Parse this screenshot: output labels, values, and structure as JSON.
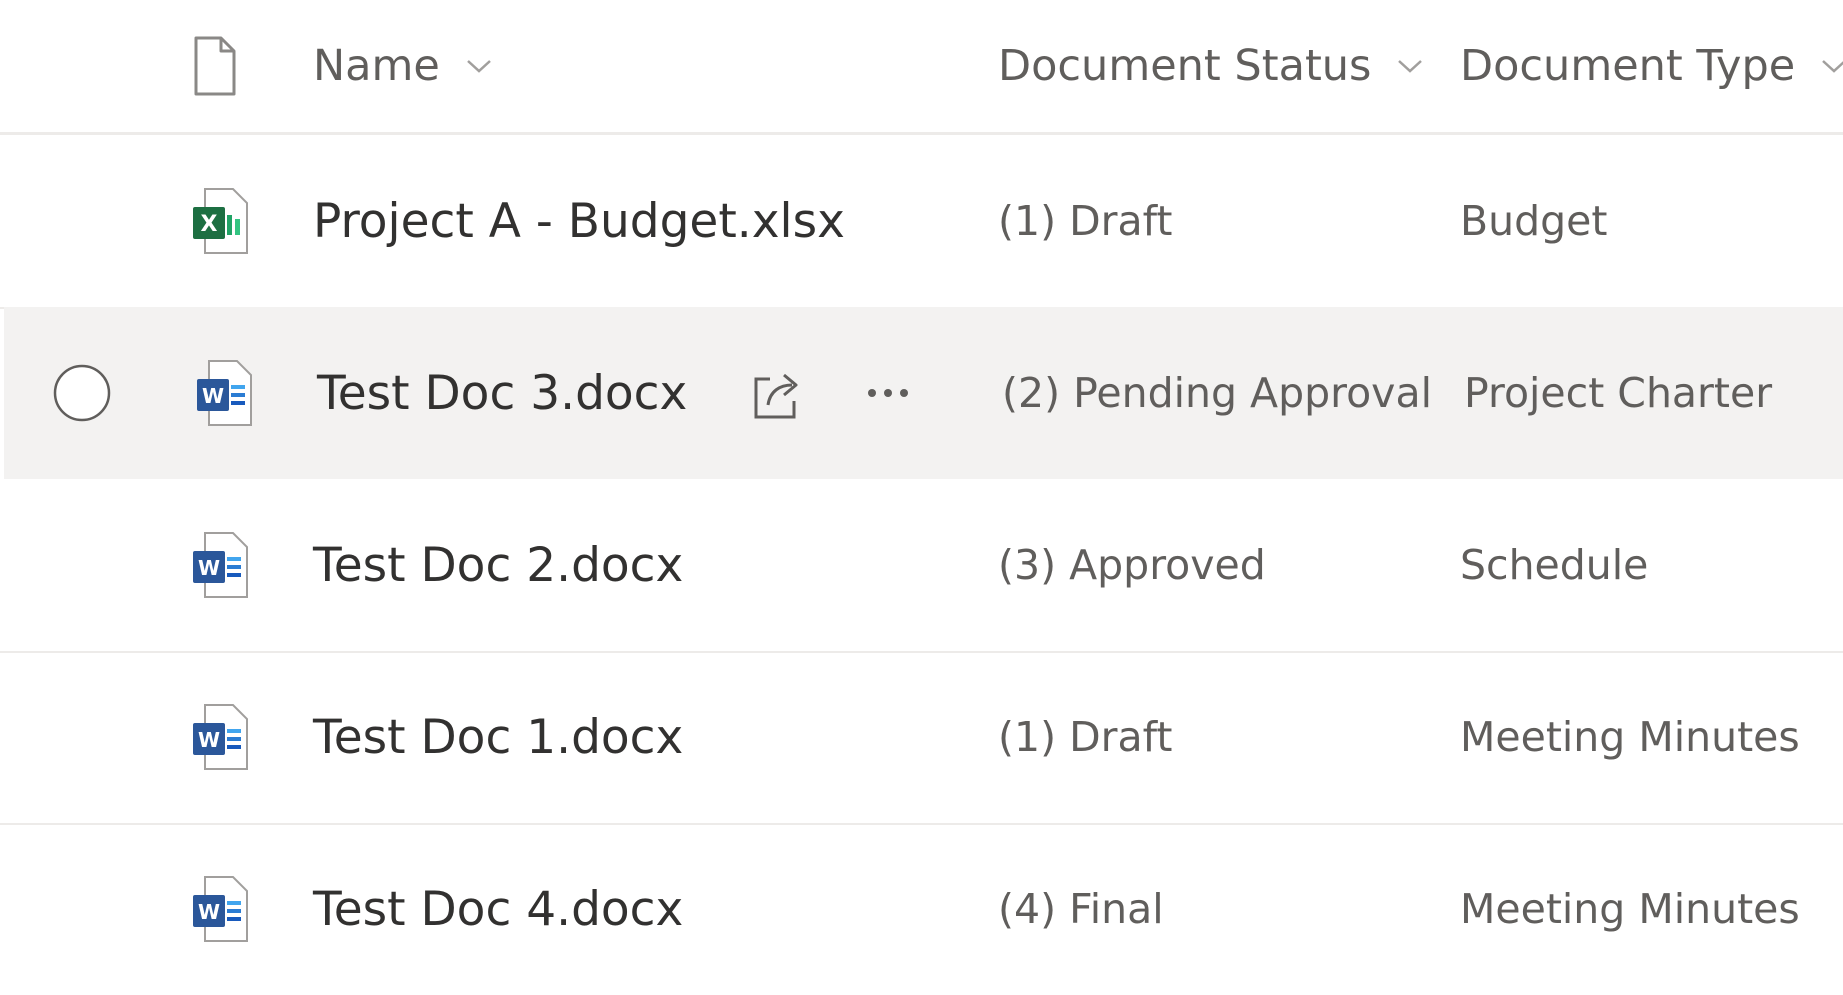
{
  "columns": {
    "file_type_icon": "document-icon",
    "name": "Name",
    "status": "Document Status",
    "type": "Document Type"
  },
  "rows": [
    {
      "name": "Project A - Budget.xlsx",
      "icon": "excel-file-icon",
      "status": "(1) Draft",
      "type": "Budget",
      "selected": false
    },
    {
      "name": "Test Doc 3.docx",
      "icon": "word-file-icon",
      "status": "(2) Pending Approval",
      "type": "Project Charter",
      "selected": true
    },
    {
      "name": "Test Doc 2.docx",
      "icon": "word-file-icon",
      "status": "(3) Approved",
      "type": "Schedule",
      "selected": false
    },
    {
      "name": "Test Doc 1.docx",
      "icon": "word-file-icon",
      "status": "(1) Draft",
      "type": "Meeting Minutes",
      "selected": false
    },
    {
      "name": "Test Doc 4.docx",
      "icon": "word-file-icon",
      "status": "(4) Final",
      "type": "Meeting Minutes",
      "selected": false
    }
  ],
  "colors": {
    "excel_green": "#1d6f42",
    "word_blue": "#2b579a",
    "row_hover": "#f3f2f1",
    "divider": "#edebe9"
  }
}
